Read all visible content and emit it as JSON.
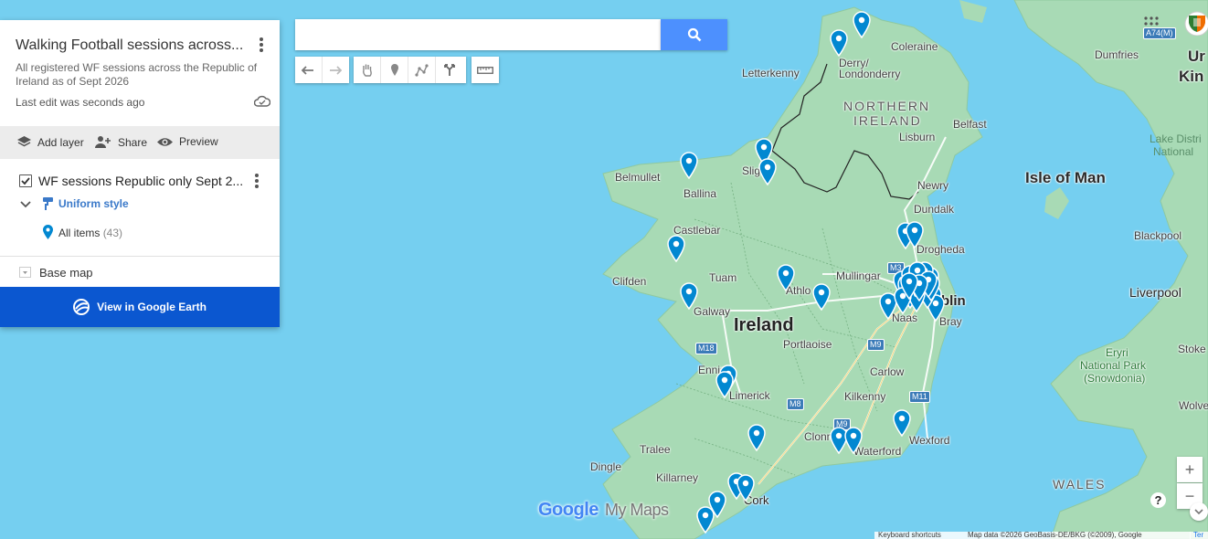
{
  "panel": {
    "title": "Walking Football sessions across...",
    "description": "All registered WF sessions across the Republic of Ireland as of Sept 2026",
    "last_edit": "Last edit was seconds ago",
    "add_layer": "Add layer",
    "share": "Share",
    "preview": "Preview",
    "layer_title": "WF sessions Republic only Sept 2...",
    "style_label": "Uniform style",
    "all_items_label": "All items",
    "all_items_count": "(43)",
    "base_map": "Base map",
    "google_earth": "View in Google Earth"
  },
  "search": {
    "value": "",
    "placeholder": ""
  },
  "toolbar": {
    "undo": "undo-icon",
    "redo": "redo-icon",
    "hand": "hand-icon",
    "marker": "marker-icon",
    "line": "draw-line-icon",
    "directions": "directions-icon",
    "ruler": "ruler-icon"
  },
  "map": {
    "labels": {
      "ireland": "Ireland",
      "northern_ireland_1": "NORTHERN",
      "northern_ireland_2": "IRELAND",
      "isle_of_man": "Isle of Man",
      "wales": "WALES",
      "united_kingdom_1": "Ur",
      "united_kingdom_2": "Kin",
      "lake_district_1": "Lake Distri",
      "lake_district_2": "National",
      "eryri_1": "Eryri",
      "eryri_2": "National Park",
      "eryri_3": "(Snowdonia)",
      "coleraine": "Coleraine",
      "derry_1": "Derry/",
      "derry_2": "Londonderry",
      "letterkenny": "Letterkenny",
      "belfast": "Belfast",
      "lisburn": "Lisburn",
      "newry": "Newry",
      "dundalk": "Dundalk",
      "drogheda": "Drogheda",
      "belmullet": "Belmullet",
      "ballina": "Ballina",
      "sligo": "Slig",
      "castlebar": "Castlebar",
      "clifden": "Clifden",
      "tuam": "Tuam",
      "galway": "Galway",
      "mullingar": "Mullingar",
      "athlone": "Athlo",
      "dublin": "blin",
      "naas": "Naas",
      "bray": "Bray",
      "portlaoise": "Portlaoise",
      "carlow": "Carlow",
      "ennis": "Ennis",
      "limerick": "Limerick",
      "kilkenny": "Kilkenny",
      "wexford": "Wexford",
      "clonmel": "Clonm",
      "waterford": "Waterford",
      "tralee": "Tralee",
      "dingle": "Dingle",
      "killarney": "Killarney",
      "cork": "Cork",
      "dumfries": "Dumfries",
      "blackpool": "Blackpool",
      "liverpool": "Liverpool",
      "stoke": "Stoke",
      "wolve": "Wolve"
    },
    "road_shields": [
      "M3",
      "M9",
      "M18",
      "M8",
      "M9",
      "M11",
      "A74(M)"
    ],
    "marker_count": 43,
    "marker_color": "#0288d1",
    "land_color": "#a8dab5",
    "water_color": "#75cff0",
    "border_color": "#222222"
  },
  "footer": {
    "keyboard": "Keyboard shortcuts",
    "attribution": "Map data ©2026 GeoBasis-DE/BKG (©2009), Google",
    "terms": "Ter"
  },
  "logo": {
    "google": "Google",
    "my_maps": "My Maps"
  }
}
